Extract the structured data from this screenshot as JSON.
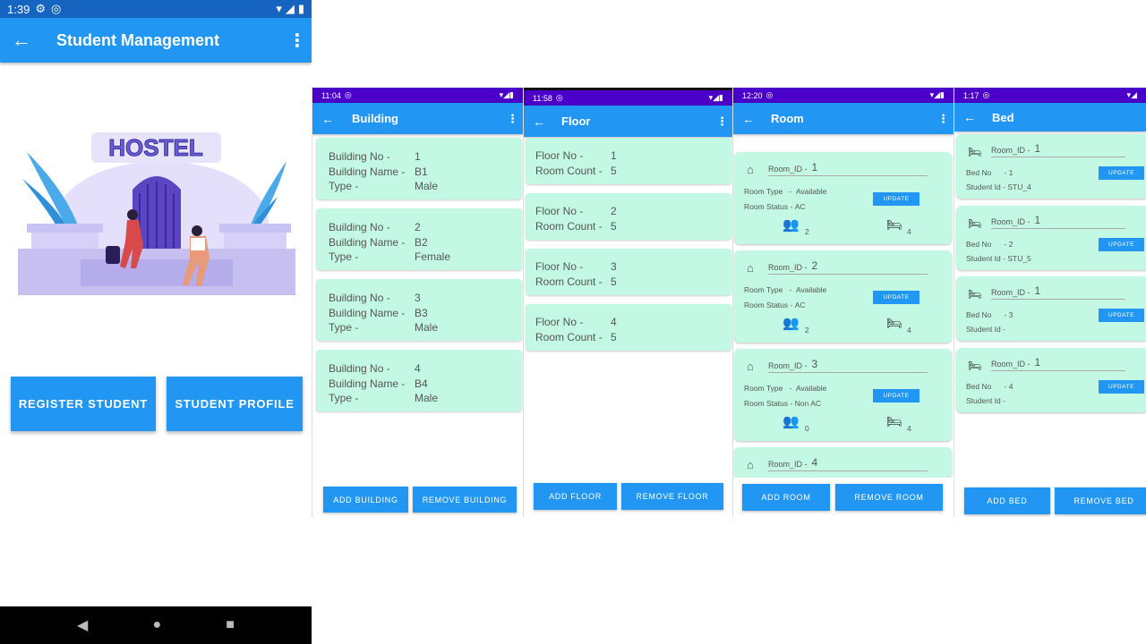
{
  "main": {
    "status_time": "1:39",
    "title": "Student Management",
    "illustration_text": "HOSTEL",
    "register_label": "REGISTER STUDENT",
    "profile_label": "STUDENT PROFILE"
  },
  "building": {
    "status_time": "11:04",
    "title": "Building",
    "labels": {
      "no": "Building No -",
      "name": "Building Name -",
      "type": "Type -"
    },
    "items": [
      {
        "no": "1",
        "name": "B1",
        "type": "Male"
      },
      {
        "no": "2",
        "name": "B2",
        "type": "Female"
      },
      {
        "no": "3",
        "name": "B3",
        "type": "Male"
      },
      {
        "no": "4",
        "name": "B4",
        "type": "Male"
      }
    ],
    "add_label": "ADD BUILDING",
    "remove_label": "REMOVE BUILDING"
  },
  "floor": {
    "status_time": "11:58",
    "title": "Floor",
    "labels": {
      "no": "Floor No -",
      "count": "Room Count -"
    },
    "items": [
      {
        "no": "1",
        "count": "5"
      },
      {
        "no": "2",
        "count": "5"
      },
      {
        "no": "3",
        "count": "5"
      },
      {
        "no": "4",
        "count": "5"
      }
    ],
    "add_label": "ADD FLOOR",
    "remove_label": "REMOVE FLOOR"
  },
  "room": {
    "status_time": "12:20",
    "title": "Room",
    "labels": {
      "id": "Room_ID -",
      "type": "Room Type",
      "type_sep": "-",
      "status": "Room Status -"
    },
    "update_label": "UPDATE",
    "items": [
      {
        "id": "1",
        "type": "Available",
        "status": "AC",
        "people": "2",
        "beds": "4"
      },
      {
        "id": "2",
        "type": "Available",
        "status": "AC",
        "people": "2",
        "beds": "4"
      },
      {
        "id": "3",
        "type": "Available",
        "status": "Non AC",
        "people": "0",
        "beds": "4"
      },
      {
        "id": "4"
      }
    ],
    "add_label": "ADD ROOM",
    "remove_label": "REMOVE ROOM"
  },
  "bed": {
    "status_time": "1:17",
    "title": "Bed",
    "labels": {
      "room": "Room_ID -",
      "bed": "Bed No",
      "student": "Student Id -"
    },
    "update_label": "UPDATE",
    "items": [
      {
        "room": "1",
        "bed": "- 1",
        "student": "STU_4"
      },
      {
        "room": "1",
        "bed": "- 2",
        "student": "STU_5"
      },
      {
        "room": "1",
        "bed": "- 3",
        "student": ""
      },
      {
        "room": "1",
        "bed": "- 4",
        "student": ""
      }
    ],
    "add_label": "ADD BED",
    "remove_label": "REMOVE BED"
  },
  "colors": {
    "primary": "#2196f3",
    "card": "#c3f8e4",
    "status_small": "#4a00c9",
    "status_main": "#1565c0"
  }
}
